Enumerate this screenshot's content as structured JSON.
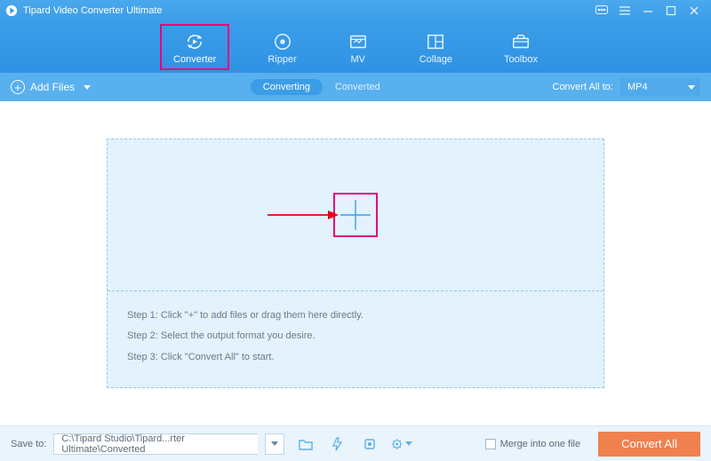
{
  "app": {
    "title": "Tipard Video Converter Ultimate"
  },
  "tabs": {
    "converter": "Converter",
    "ripper": "Ripper",
    "mv": "MV",
    "collage": "Collage",
    "toolbox": "Toolbox"
  },
  "toolbar": {
    "add_files": "Add Files",
    "converting": "Converting",
    "converted": "Converted",
    "convert_all_to": "Convert All to:",
    "format": "MP4"
  },
  "dropzone": {
    "step1": "Step 1: Click \"+\" to add files or drag them here directly.",
    "step2": "Step 2: Select the output format you desire.",
    "step3": "Step 3: Click \"Convert All\" to start."
  },
  "footer": {
    "save_to": "Save to:",
    "path": "C:\\Tipard Studio\\Tipard...rter Ultimate\\Converted",
    "merge": "Merge into one file",
    "convert_all": "Convert All"
  },
  "colors": {
    "accent": "#3b9de8",
    "highlight": "#e6007e",
    "cta": "#f0814f"
  }
}
